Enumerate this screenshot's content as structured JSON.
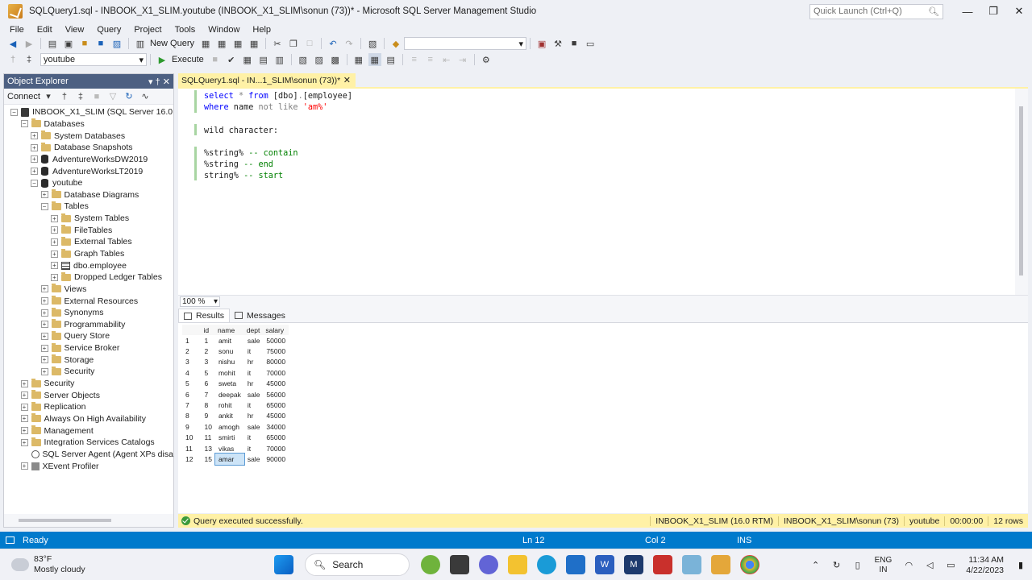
{
  "window": {
    "title": "SQLQuery1.sql - INBOOK_X1_SLIM.youtube (INBOOK_X1_SLIM\\sonun (73))* - Microsoft SQL Server Management Studio",
    "quick_launch_placeholder": "Quick Launch (Ctrl+Q)"
  },
  "menu": [
    "File",
    "Edit",
    "View",
    "Query",
    "Project",
    "Tools",
    "Window",
    "Help"
  ],
  "toolbar1": {
    "new_query_label": "New Query"
  },
  "toolbar2": {
    "database_selected": "youtube",
    "execute_label": "Execute"
  },
  "object_explorer": {
    "title": "Object Explorer",
    "connect_label": "Connect",
    "tree": [
      {
        "level": 0,
        "exp": "-",
        "icon": "server",
        "label": "INBOOK_X1_SLIM (SQL Server 16.0.1000.6"
      },
      {
        "level": 1,
        "exp": "-",
        "icon": "folder",
        "label": "Databases"
      },
      {
        "level": 2,
        "exp": "+",
        "icon": "folder",
        "label": "System Databases"
      },
      {
        "level": 2,
        "exp": "+",
        "icon": "folder",
        "label": "Database Snapshots"
      },
      {
        "level": 2,
        "exp": "+",
        "icon": "db",
        "label": "AdventureWorksDW2019"
      },
      {
        "level": 2,
        "exp": "+",
        "icon": "db",
        "label": "AdventureWorksLT2019"
      },
      {
        "level": 2,
        "exp": "-",
        "icon": "db",
        "label": "youtube"
      },
      {
        "level": 3,
        "exp": "+",
        "icon": "folder",
        "label": "Database Diagrams"
      },
      {
        "level": 3,
        "exp": "-",
        "icon": "folder",
        "label": "Tables"
      },
      {
        "level": 4,
        "exp": "+",
        "icon": "folder",
        "label": "System Tables"
      },
      {
        "level": 4,
        "exp": "+",
        "icon": "folder",
        "label": "FileTables"
      },
      {
        "level": 4,
        "exp": "+",
        "icon": "folder",
        "label": "External Tables"
      },
      {
        "level": 4,
        "exp": "+",
        "icon": "folder",
        "label": "Graph Tables"
      },
      {
        "level": 4,
        "exp": "+",
        "icon": "grid",
        "label": "dbo.employee"
      },
      {
        "level": 4,
        "exp": "+",
        "icon": "folder",
        "label": "Dropped Ledger Tables"
      },
      {
        "level": 3,
        "exp": "+",
        "icon": "folder",
        "label": "Views"
      },
      {
        "level": 3,
        "exp": "+",
        "icon": "folder",
        "label": "External Resources"
      },
      {
        "level": 3,
        "exp": "+",
        "icon": "folder",
        "label": "Synonyms"
      },
      {
        "level": 3,
        "exp": "+",
        "icon": "folder",
        "label": "Programmability"
      },
      {
        "level": 3,
        "exp": "+",
        "icon": "folder",
        "label": "Query Store"
      },
      {
        "level": 3,
        "exp": "+",
        "icon": "folder",
        "label": "Service Broker"
      },
      {
        "level": 3,
        "exp": "+",
        "icon": "folder",
        "label": "Storage"
      },
      {
        "level": 3,
        "exp": "+",
        "icon": "folder",
        "label": "Security"
      },
      {
        "level": 1,
        "exp": "+",
        "icon": "folder",
        "label": "Security"
      },
      {
        "level": 1,
        "exp": "+",
        "icon": "folder",
        "label": "Server Objects"
      },
      {
        "level": 1,
        "exp": "+",
        "icon": "folder",
        "label": "Replication"
      },
      {
        "level": 1,
        "exp": "+",
        "icon": "folder",
        "label": "Always On High Availability"
      },
      {
        "level": 1,
        "exp": "+",
        "icon": "folder",
        "label": "Management"
      },
      {
        "level": 1,
        "exp": "+",
        "icon": "folder",
        "label": "Integration Services Catalogs"
      },
      {
        "level": 1,
        "exp": "",
        "icon": "agent",
        "label": "SQL Server Agent (Agent XPs disabled)"
      },
      {
        "level": 1,
        "exp": "+",
        "icon": "xevent",
        "label": "XEvent Profiler"
      }
    ]
  },
  "editor": {
    "tab_label": "SQLQuery1.sql - IN...1_SLIM\\sonun (73))*",
    "lines": [
      [
        {
          "t": "select",
          "c": "kw"
        },
        {
          "t": " ",
          "c": ""
        },
        {
          "t": "*",
          "c": "op"
        },
        {
          "t": " ",
          "c": ""
        },
        {
          "t": "from",
          "c": "kw"
        },
        {
          "t": " [dbo]",
          "c": ""
        },
        {
          "t": ".",
          "c": "op"
        },
        {
          "t": "[employee]",
          "c": ""
        }
      ],
      [
        {
          "t": "where",
          "c": "kw"
        },
        {
          "t": " name ",
          "c": ""
        },
        {
          "t": "not like",
          "c": "op"
        },
        {
          "t": " ",
          "c": ""
        },
        {
          "t": "'am%'",
          "c": "str"
        }
      ],
      [],
      [
        {
          "t": "wild character:",
          "c": ""
        }
      ],
      [],
      [
        {
          "t": "%string% ",
          "c": ""
        },
        {
          "t": "-- contain",
          "c": "cm"
        }
      ],
      [
        {
          "t": "%string ",
          "c": ""
        },
        {
          "t": "-- end",
          "c": "cm"
        }
      ],
      [
        {
          "t": "string% ",
          "c": ""
        },
        {
          "t": "-- start",
          "c": "cm"
        }
      ]
    ],
    "zoom": "100 %"
  },
  "results": {
    "tabs": [
      "Results",
      "Messages"
    ],
    "columns": [
      "id",
      "name",
      "dept",
      "salary"
    ],
    "rows": [
      [
        "1",
        "1",
        "amit",
        "sale",
        "50000"
      ],
      [
        "2",
        "2",
        "sonu",
        "it",
        "75000"
      ],
      [
        "3",
        "3",
        "nishu",
        "hr",
        "80000"
      ],
      [
        "4",
        "5",
        "mohit",
        "it",
        "70000"
      ],
      [
        "5",
        "6",
        "sweta",
        "hr",
        "45000"
      ],
      [
        "6",
        "7",
        "deepak",
        "sale",
        "56000"
      ],
      [
        "7",
        "8",
        "rohit",
        "it",
        "65000"
      ],
      [
        "8",
        "9",
        "ankit",
        "hr",
        "45000"
      ],
      [
        "9",
        "10",
        "amogh",
        "sale",
        "34000"
      ],
      [
        "10",
        "11",
        "smirti",
        "it",
        "65000"
      ],
      [
        "11",
        "13",
        "vikas",
        "it",
        "70000"
      ],
      [
        "12",
        "15",
        "amar",
        "sale",
        "90000"
      ]
    ],
    "selected_row": 11
  },
  "query_status": {
    "message": "Query executed successfully.",
    "server": "INBOOK_X1_SLIM (16.0 RTM)",
    "user": "INBOOK_X1_SLIM\\sonun (73)",
    "database": "youtube",
    "elapsed": "00:00:00",
    "rows": "12 rows"
  },
  "app_status": {
    "state": "Ready",
    "line": "Ln 12",
    "col": "Col 2",
    "mode": "INS"
  },
  "taskbar": {
    "weather_temp": "83°F",
    "weather_desc": "Mostly cloudy",
    "search_label": "Search",
    "lang1": "ENG",
    "lang2": "IN",
    "time": "11:34 AM",
    "date": "4/22/2023"
  },
  "colors": {
    "accent_blue": "#007acc",
    "tab_yellow": "#fff1a6",
    "oe_header": "#4d6082"
  }
}
